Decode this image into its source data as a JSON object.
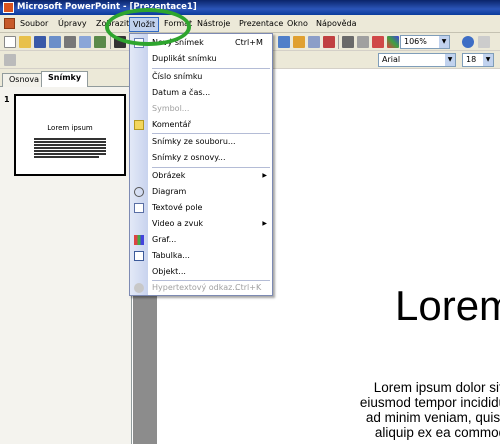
{
  "window": {
    "title": "Microsoft PowerPoint - [Prezentace1]"
  },
  "menubar": {
    "items": [
      "Soubor",
      "Úpravy",
      "Zobrazit",
      "Vložit",
      "Formát",
      "Nástroje",
      "Prezentace",
      "Okno",
      "Nápověda"
    ],
    "active": "Vložit"
  },
  "toolbar": {
    "zoom": "106%"
  },
  "format_toolbar": {
    "font": "Arial",
    "size": "18"
  },
  "left_pane": {
    "tabs": [
      "Osnova",
      "Snímky"
    ],
    "selected_tab": "Snímky",
    "slide_number": "1",
    "thumb_title": "Lorem ipsum"
  },
  "slide": {
    "title": "Lorem",
    "body_lines": [
      "Lorem ipsum dolor sit amet,",
      "eiusmod tempor incididunt ut lab",
      "ad minim veniam, quis nostruc",
      "aliquip ex ea commodo con"
    ]
  },
  "insert_menu": {
    "items": [
      {
        "label": "Nový snímek",
        "shortcut": "Ctrl+M",
        "icon": "new-slide-icon"
      },
      {
        "label": "Duplikát snímku"
      },
      {
        "label": "Číslo snímku"
      },
      {
        "label": "Datum a čas..."
      },
      {
        "label": "Symbol...",
        "disabled": true
      },
      {
        "label": "Komentář",
        "icon": "comment-icon"
      },
      {
        "label": "Snímky ze souboru..."
      },
      {
        "label": "Snímky z osnovy..."
      },
      {
        "label": "Obrázek",
        "submenu": true
      },
      {
        "label": "Diagram",
        "icon": "diagram-icon"
      },
      {
        "label": "Textové pole",
        "icon": "textbox-icon"
      },
      {
        "label": "Video a zvuk",
        "submenu": true
      },
      {
        "label": "Graf...",
        "icon": "chart-icon"
      },
      {
        "label": "Tabulka...",
        "icon": "table-icon"
      },
      {
        "label": "Objekt..."
      },
      {
        "label": "Hypertextový odkaz...",
        "shortcut": "Ctrl+K",
        "disabled": true,
        "icon": "hyperlink-icon"
      }
    ]
  },
  "colors": {
    "highlight_ring": "#2ea52e",
    "title_bar": "#0a246a"
  }
}
